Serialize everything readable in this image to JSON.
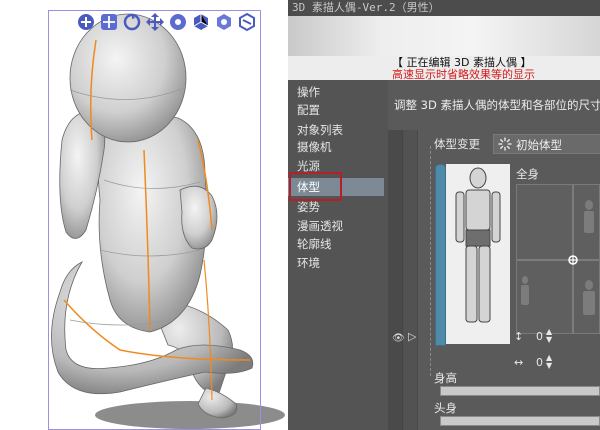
{
  "window_title": "3D 素描人偶-Ver.2（男性）",
  "editing": {
    "title": "【 正在编辑 3D 素描人偶 】",
    "subtitle": "高速显示时省略效果等的显示"
  },
  "nav": {
    "items": [
      {
        "label": "操作",
        "active": false
      },
      {
        "label": "配置",
        "active": false
      },
      {
        "label": "对象列表",
        "active": false
      },
      {
        "label": "摄像机",
        "active": false
      },
      {
        "label": "光源",
        "active": false
      },
      {
        "label": "体型",
        "active": true
      },
      {
        "label": "姿势",
        "active": false
      },
      {
        "label": "漫画透视",
        "active": false
      },
      {
        "label": "轮廓线",
        "active": false
      },
      {
        "label": "环境",
        "active": false
      }
    ],
    "highlight_color": "#b3202a"
  },
  "detail": {
    "header": "调整 3D 素描人偶的体型和各部位的尺寸",
    "body_type_label": "体型变更",
    "initial_button": "初始体型",
    "full_body_label": "全身",
    "stepper_v_value": "0",
    "stepper_h_value": "0",
    "height_label": "身高",
    "head_label": "头身"
  },
  "manipulator_icons": [
    "move-camera-icon",
    "pan-icon",
    "rotate-icon",
    "move-xy-icon",
    "move-z-icon",
    "rotate-xy-icon",
    "rotate-axis-icon",
    "scale-icon"
  ],
  "colors": {
    "accent_blue": "#4f8aa8",
    "selection": "#9a90e6",
    "warning_text": "#d31a1a",
    "guide_orange": "#f08a1e"
  }
}
